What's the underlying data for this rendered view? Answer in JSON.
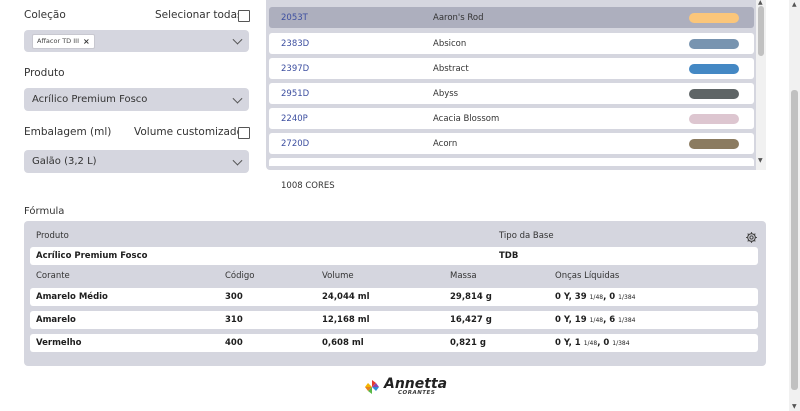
{
  "form": {
    "colecao_label": "Coleção",
    "select_all_label": "Selecionar todas",
    "colecao_chip": "Affacor TD III",
    "produto_label": "Produto",
    "produto_value": "Acrílico Premium Fosco",
    "embalagem_label": "Embalagem (ml)",
    "volume_custom_label": "Volume customizado",
    "embalagem_value": "Galão (3,2 L)"
  },
  "colors": {
    "items": [
      {
        "code": "2053T",
        "name": "Aaron's Rod",
        "swatch": "#fbc67a",
        "selected": true
      },
      {
        "code": "2383D",
        "name": "Absicon",
        "swatch": "#7894b0"
      },
      {
        "code": "2397D",
        "name": "Abstract",
        "swatch": "#4488c4"
      },
      {
        "code": "2951D",
        "name": "Abyss",
        "swatch": "#5f6566"
      },
      {
        "code": "2240P",
        "name": "Acacia Blossom",
        "swatch": "#ddc6d0"
      },
      {
        "code": "2720D",
        "name": "Acorn",
        "swatch": "#8b7b60"
      }
    ],
    "count_label": "1008 CORES"
  },
  "formula": {
    "title": "Fórmula",
    "produto_header": "Produto",
    "tipo_base_header": "Tipo da Base",
    "produto_value": "Acrílico Premium Fosco",
    "tipo_base_value": "TDB",
    "columns": [
      "Corante",
      "Código",
      "Volume",
      "Massa",
      "Onças Líquidas"
    ],
    "rows": [
      {
        "corante": "Amarelo Médio",
        "codigo": "300",
        "volume": "24,044 ml",
        "massa": "29,814 g",
        "oz_main": "0 Y, 39",
        "oz_f1": "1/48",
        "oz_mid": ", 0",
        "oz_f2": "1/384"
      },
      {
        "corante": "Amarelo",
        "codigo": "310",
        "volume": "12,168 ml",
        "massa": "16,427 g",
        "oz_main": "0 Y, 19",
        "oz_f1": "1/48",
        "oz_mid": ", 6",
        "oz_f2": "1/384"
      },
      {
        "corante": "Vermelho",
        "codigo": "400",
        "volume": "0,608 ml",
        "massa": "0,821 g",
        "oz_main": "0 Y, 1",
        "oz_f1": "1/48",
        "oz_mid": ", 0",
        "oz_f2": "1/384"
      }
    ]
  },
  "logo": {
    "name": "Annetta",
    "sub": "CORANTES"
  },
  "icons": {
    "settings": "gear-icon",
    "chevron": "chevron-down-icon",
    "remove": "close-icon"
  }
}
